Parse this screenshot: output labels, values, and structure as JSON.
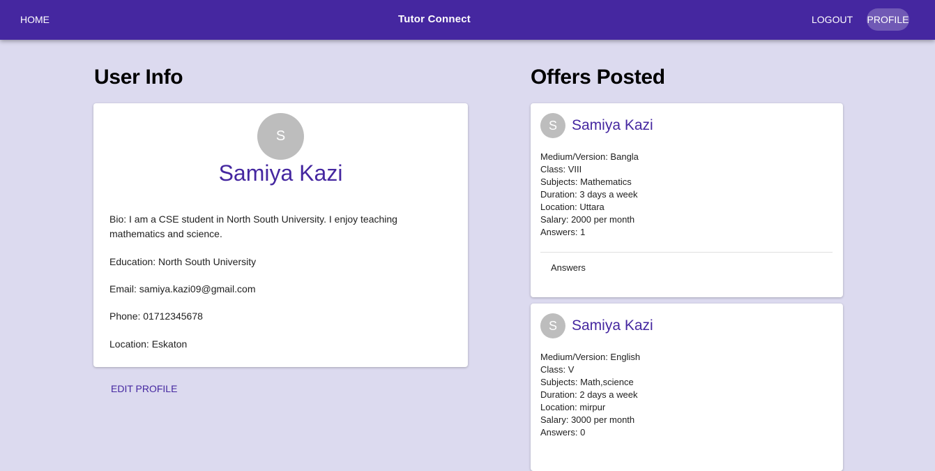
{
  "nav": {
    "home": "HOME",
    "title": "Tutor Connect",
    "logout": "LOGOUT",
    "profile": "PROFILE"
  },
  "user_section": {
    "heading": "User Info",
    "avatar_initial": "S",
    "name": "Samiya Kazi",
    "bio": "Bio: I am a CSE student in North South University. I enjoy teaching mathematics and science.",
    "education": "Education: North South University",
    "email": "Email: samiya.kazi09@gmail.com",
    "phone": "Phone: 01712345678",
    "location": "Location: Eskaton",
    "edit_label": "EDIT PROFILE"
  },
  "offers_section": {
    "heading": "Offers Posted",
    "offers": [
      {
        "avatar_initial": "S",
        "name": "Samiya Kazi",
        "medium": "Medium/Version: Bangla",
        "class": "Class: VIII",
        "subjects": "Subjects: Mathematics",
        "duration": "Duration: 3 days a week",
        "location": "Location: Uttara",
        "salary": "Salary: 2000 per month",
        "answers": "Answers: 1",
        "answers_toggle": "Answers"
      },
      {
        "avatar_initial": "S",
        "name": "Samiya Kazi",
        "medium": "Medium/Version: English",
        "class": "Class: V",
        "subjects": "Subjects: Math,science",
        "duration": "Duration: 2 days a week",
        "location": "Location: mirpur",
        "salary": "Salary: 3000 per month",
        "answers": "Answers: 0"
      }
    ]
  },
  "colors": {
    "appbar": "#4527a0",
    "background": "#dcdaef",
    "accent_text": "#4527a0",
    "avatar": "#bdbdbd"
  }
}
